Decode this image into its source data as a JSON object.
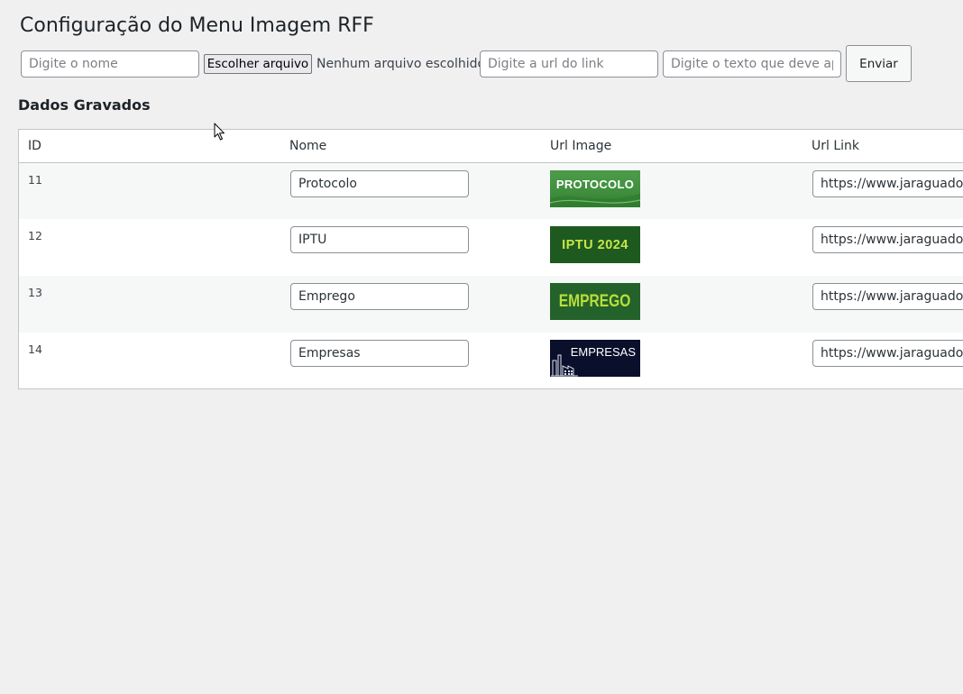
{
  "page": {
    "title": "Configuração do Menu Imagem RFF"
  },
  "form": {
    "name_placeholder": "Digite o nome",
    "file_button_label": "Escolher arquivo",
    "file_status": "Nenhum arquivo escolhido",
    "url_placeholder": "Digite a url do link",
    "text_placeholder": "Digite o texto que deve aparecer",
    "submit_label": "Enviar"
  },
  "section": {
    "heading": "Dados Gravados"
  },
  "table": {
    "headers": {
      "id": "ID",
      "nome": "Nome",
      "url_image": "Url Image",
      "url_link": "Url Link"
    },
    "rows": [
      {
        "id": "11",
        "nome": "Protocolo",
        "image_text": "PROTOCOLO",
        "url_link": "https://www.jaraguadosul.sc.gov.br"
      },
      {
        "id": "12",
        "nome": "IPTU",
        "image_text": "IPTU 2024",
        "url_link": "https://www.jaraguadosul.sc.gov.br"
      },
      {
        "id": "13",
        "nome": "Emprego",
        "image_text": "EMPREGO",
        "url_link": "https://www.jaraguadosul.sc.gov.br"
      },
      {
        "id": "14",
        "nome": "Empresas",
        "image_text": "EMPRESAS",
        "url_link": "https://www.jaraguadosul.sc.gov.br"
      }
    ]
  }
}
